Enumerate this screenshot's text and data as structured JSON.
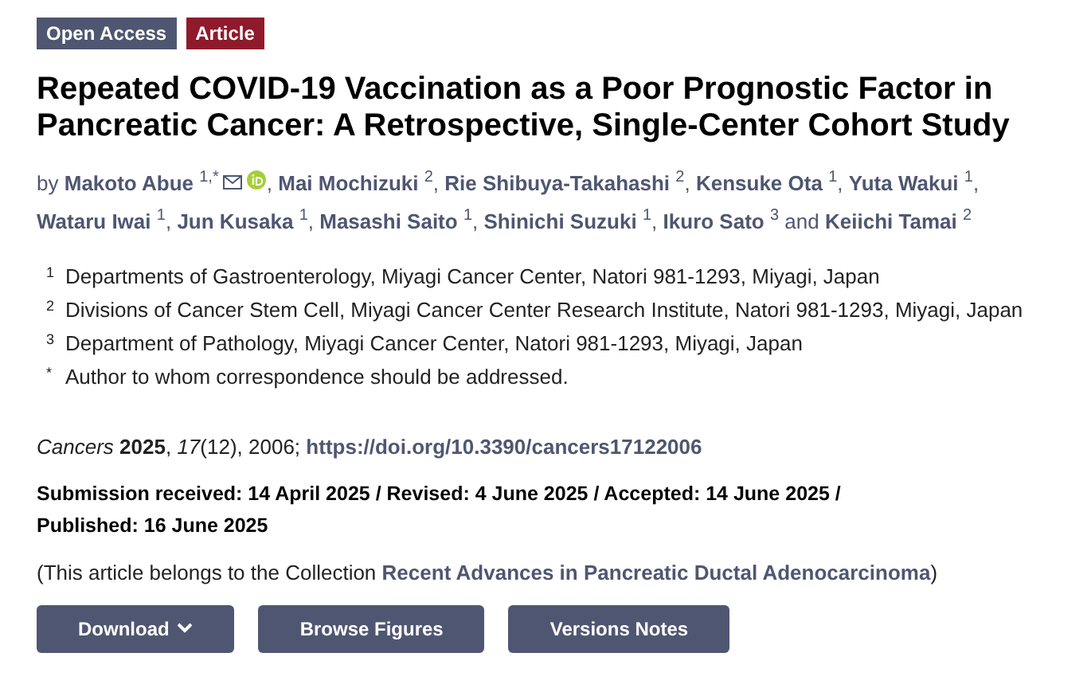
{
  "badges": [
    {
      "label": "Open Access",
      "kind": "access"
    },
    {
      "label": "Article",
      "kind": "type"
    }
  ],
  "title": "Repeated COVID-19 Vaccination as a Poor Prognostic Factor in Pancreatic Cancer: A Retrospective, Single-Center Cohort Study",
  "by": "by",
  "authors": [
    {
      "name": "Makoto Abue",
      "sup": "1,*",
      "icons": [
        {
          "kind": "mail"
        },
        {
          "kind": "orcid"
        }
      ],
      "after": ","
    },
    {
      "name": "Mai Mochizuki",
      "sup": "2",
      "after": ","
    },
    {
      "name": "Rie Shibuya-Takahashi",
      "sup": "2",
      "after": ","
    },
    {
      "name": "Kensuke Ota",
      "sup": "1",
      "after": ","
    },
    {
      "name": "Yuta Wakui",
      "sup": "1",
      "after": ","
    },
    {
      "name": "Wataru Iwai",
      "sup": "1",
      "after": ","
    },
    {
      "name": "Jun Kusaka",
      "sup": "1",
      "after": ","
    },
    {
      "name": "Masashi Saito",
      "sup": "1",
      "after": ","
    },
    {
      "name": "Shinichi Suzuki",
      "sup": "1",
      "after": ","
    },
    {
      "name": "Ikuro Sato",
      "sup": "3",
      "after": "and"
    },
    {
      "name": "Keiichi Tamai",
      "sup": "2"
    }
  ],
  "affiliations": [
    {
      "mark": "1",
      "text": "Departments of Gastroenterology, Miyagi Cancer Center, Natori 981-1293, Miyagi, Japan"
    },
    {
      "mark": "2",
      "text": "Divisions of Cancer Stem Cell, Miyagi Cancer Center Research Institute, Natori 981-1293, Miyagi, Japan"
    },
    {
      "mark": "3",
      "text": "Department of Pathology, Miyagi Cancer Center, Natori 981-1293, Miyagi, Japan"
    },
    {
      "mark": "*",
      "text": "Author to whom correspondence should be addressed."
    }
  ],
  "citation": {
    "text": "*Cancers* **2025**, *17*(12), 2006;",
    "doi": "https://doi.org/10.3390/cancers17122006"
  },
  "dates": "Submission received: 14 April 2025 / Revised: 4 June 2025 / Accepted: 14 June 2025 / Published: 16 June 2025",
  "collection": {
    "before": "(This article belongs to the Collection",
    "link": "Recent Advances in Pancreatic Ductal Adenocarcinoma",
    "after": ")"
  },
  "buttons": [
    {
      "label": "Download",
      "dropdown": true
    },
    {
      "label": "Browse Figures",
      "dropdown": false
    },
    {
      "label": "Versions Notes",
      "dropdown": false
    }
  ]
}
